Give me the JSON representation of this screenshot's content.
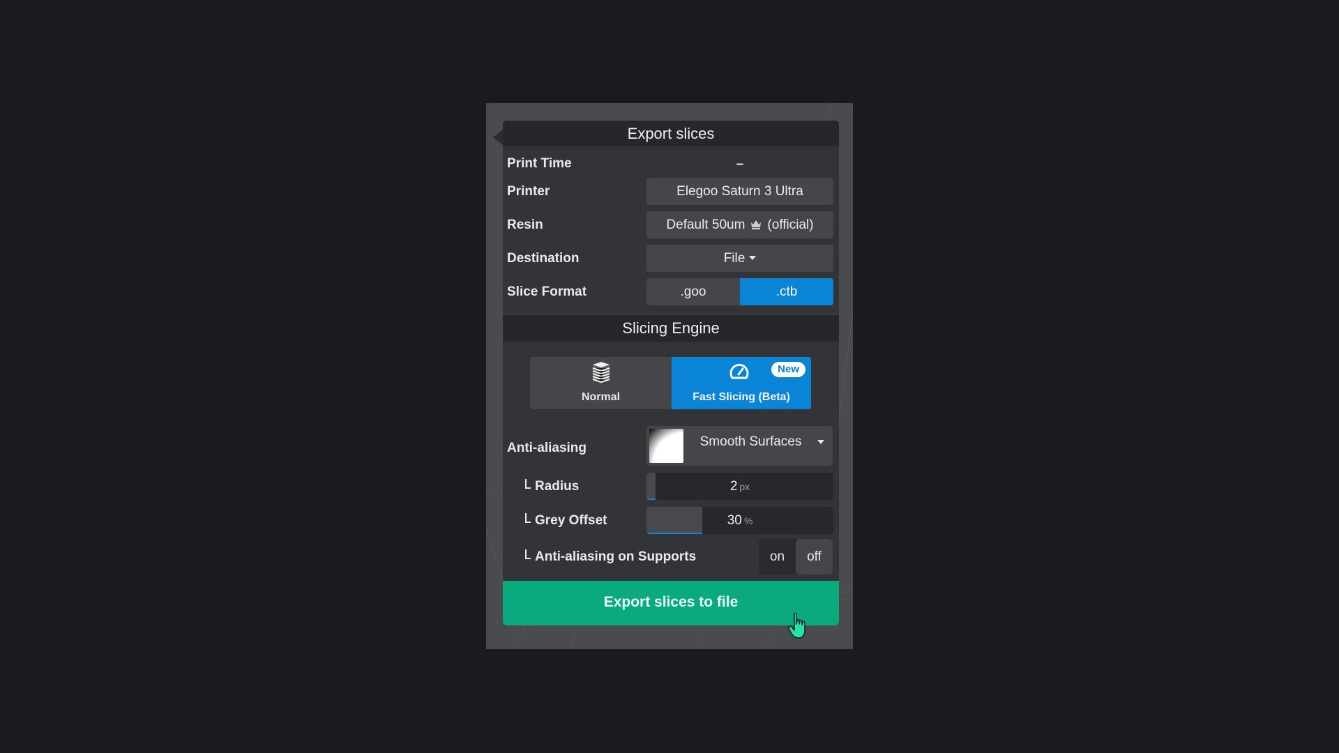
{
  "panel": {
    "title": "Export slices",
    "rows": {
      "print_time": {
        "label": "Print Time",
        "value": "–"
      },
      "printer": {
        "label": "Printer",
        "value": "Elegoo Saturn 3 Ultra"
      },
      "resin": {
        "label": "Resin",
        "value": "Default 50um",
        "suffix": "(official)",
        "icon": "crown-icon"
      },
      "destination": {
        "label": "Destination",
        "value": "File"
      },
      "slice_format": {
        "label": "Slice Format",
        "options": [
          ".goo",
          ".ctb"
        ],
        "selected": ".ctb"
      }
    },
    "slicing_engine": {
      "title": "Slicing Engine",
      "options": [
        {
          "label": "Normal",
          "icon": "layers-stack-icon",
          "selected": false
        },
        {
          "label": "Fast Slicing (Beta)",
          "icon": "speedometer-icon",
          "badge": "New",
          "selected": true
        }
      ]
    },
    "anti_aliasing": {
      "label": "Anti-aliasing",
      "value": "Smooth Surfaces",
      "radius": {
        "label": "Radius",
        "value": "2",
        "unit": "px",
        "fill_fraction": 0.05
      },
      "grey_offset": {
        "label": "Grey Offset",
        "value": "30",
        "unit": "%",
        "fill_fraction": 0.3
      },
      "supports": {
        "label": "Anti-aliasing on Supports",
        "options": [
          "on",
          "off"
        ],
        "selected": "off"
      }
    },
    "export_button": "Export slices to file"
  },
  "colors": {
    "accent_blue": "#0a84d6",
    "export_green": "#0aa97e"
  }
}
